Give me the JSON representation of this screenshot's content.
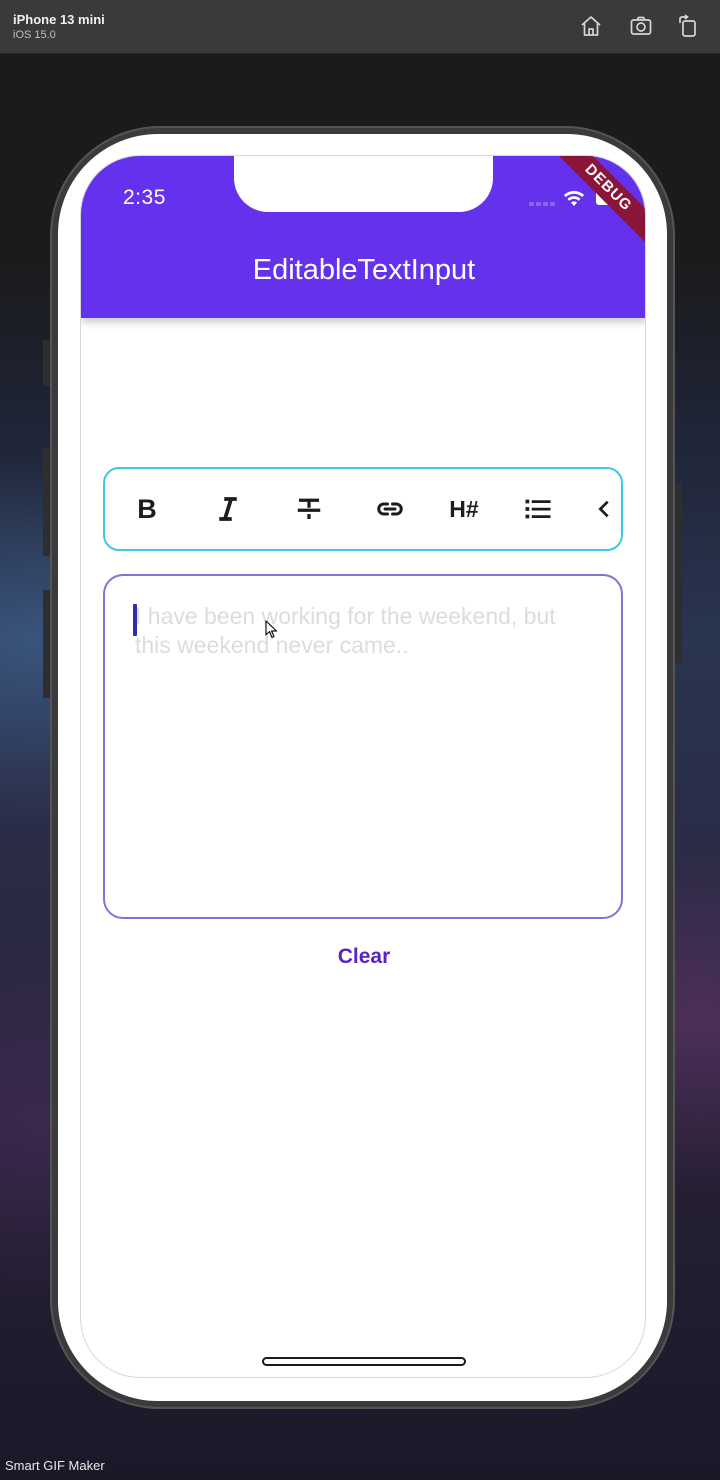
{
  "simulator": {
    "device_name": "iPhone 13 mini",
    "os_version": "iOS 15.0",
    "toolbar_icons": [
      "home-icon",
      "screenshot-icon",
      "rotate-icon"
    ]
  },
  "status_bar": {
    "time": "2:35",
    "debug_banner": "DEBUG"
  },
  "app_bar": {
    "title": "EditableTextInput",
    "color": "#6432ec"
  },
  "format_toolbar": {
    "border_color": "#3ec8e8",
    "buttons": [
      {
        "name": "bold-button",
        "icon": "bold-icon",
        "label": "B"
      },
      {
        "name": "italic-button",
        "icon": "italic-icon",
        "label": "I"
      },
      {
        "name": "strikethrough-button",
        "icon": "strikethrough-icon"
      },
      {
        "name": "link-button",
        "icon": "link-icon"
      },
      {
        "name": "heading-button",
        "icon": "heading-icon",
        "label": "H#"
      },
      {
        "name": "bullet-list-button",
        "icon": "list-icon"
      },
      {
        "name": "collapse-button",
        "icon": "chevron-left-icon"
      }
    ]
  },
  "editor": {
    "placeholder": "I have been working for the weekend, but this weekend never came..",
    "value": "",
    "border_color": "#8a6fd6"
  },
  "actions": {
    "clear_label": "Clear",
    "accent_color": "#5a22c8"
  },
  "watermark": "Smart GIF Maker"
}
